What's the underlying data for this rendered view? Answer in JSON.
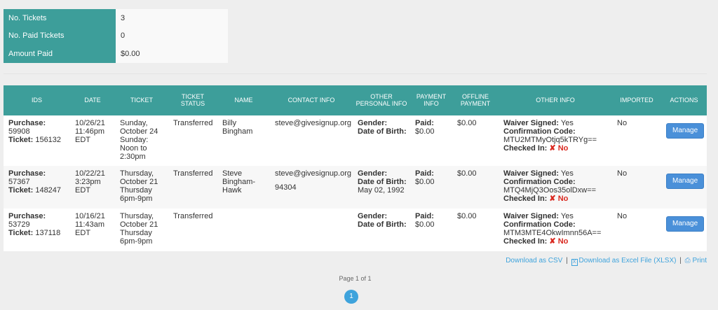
{
  "summary": [
    {
      "label": "No. Tickets",
      "value": "3"
    },
    {
      "label": "No. Paid Tickets",
      "value": "0"
    },
    {
      "label": "Amount Paid",
      "value": "$0.00"
    }
  ],
  "table": {
    "headers": [
      "IDS",
      "DATE",
      "TICKET",
      "TICKET STATUS",
      "NAME",
      "CONTACT INFO",
      "OTHER PERSONAL INFO",
      "PAYMENT INFO",
      "OFFLINE PAYMENT",
      "OTHER INFO",
      "IMPORTED",
      "ACTIONS"
    ],
    "field_labels": {
      "purchase": "Purchase:",
      "ticket": "Ticket:",
      "gender": "Gender:",
      "dob": "Date of Birth:",
      "paid": "Paid:",
      "waiver": "Waiver Signed:",
      "confirmation": "Confirmation Code:",
      "checked_in": "Checked In:",
      "no_mark": "✘ No"
    },
    "rows": [
      {
        "purchase": "59908",
        "ticket": "156132",
        "date": "10/26/21 11:46pm EDT",
        "ticket_desc": "Sunday, October 24 Sunday: Noon to 2:30pm",
        "status": "Transferred",
        "name": "Billy Bingham",
        "email": "steve@givesignup.org",
        "zip": "",
        "dob": "",
        "paid": "$0.00",
        "offline": "$0.00",
        "waiver": "Yes",
        "confirmation_code": "MTU2MTMyOtjq5kTRYg==",
        "imported": "No",
        "action": "Manage"
      },
      {
        "purchase": "57367",
        "ticket": "148247",
        "date": "10/22/21 3:23pm EDT",
        "ticket_desc": "Thursday, October 21 Thursday 6pm-9pm",
        "status": "Transferred",
        "name": "Steve Bingham-Hawk",
        "email": "steve@givesignup.org",
        "zip": "94304",
        "dob": "May 02, 1992",
        "paid": "$0.00",
        "offline": "$0.00",
        "waiver": "Yes",
        "confirmation_code": "MTQ4MjQ3Oos35olDxw==",
        "imported": "No",
        "action": "Manage"
      },
      {
        "purchase": "53729",
        "ticket": "137118",
        "date": "10/16/21 11:43am EDT",
        "ticket_desc": "Thursday, October 21 Thursday 6pm-9pm",
        "status": "Transferred",
        "name": "",
        "email": "",
        "zip": "",
        "dob": "",
        "paid": "$0.00",
        "offline": "$0.00",
        "waiver": "Yes",
        "confirmation_code": "MTM3MTE4OkwImnn56A==",
        "imported": "No",
        "action": "Manage"
      }
    ]
  },
  "downloads": {
    "csv": "Download as CSV",
    "excel": "Download as Excel File (XLSX)",
    "print": "Print"
  },
  "pagination": {
    "text": "Page 1 of 1",
    "current": "1"
  }
}
